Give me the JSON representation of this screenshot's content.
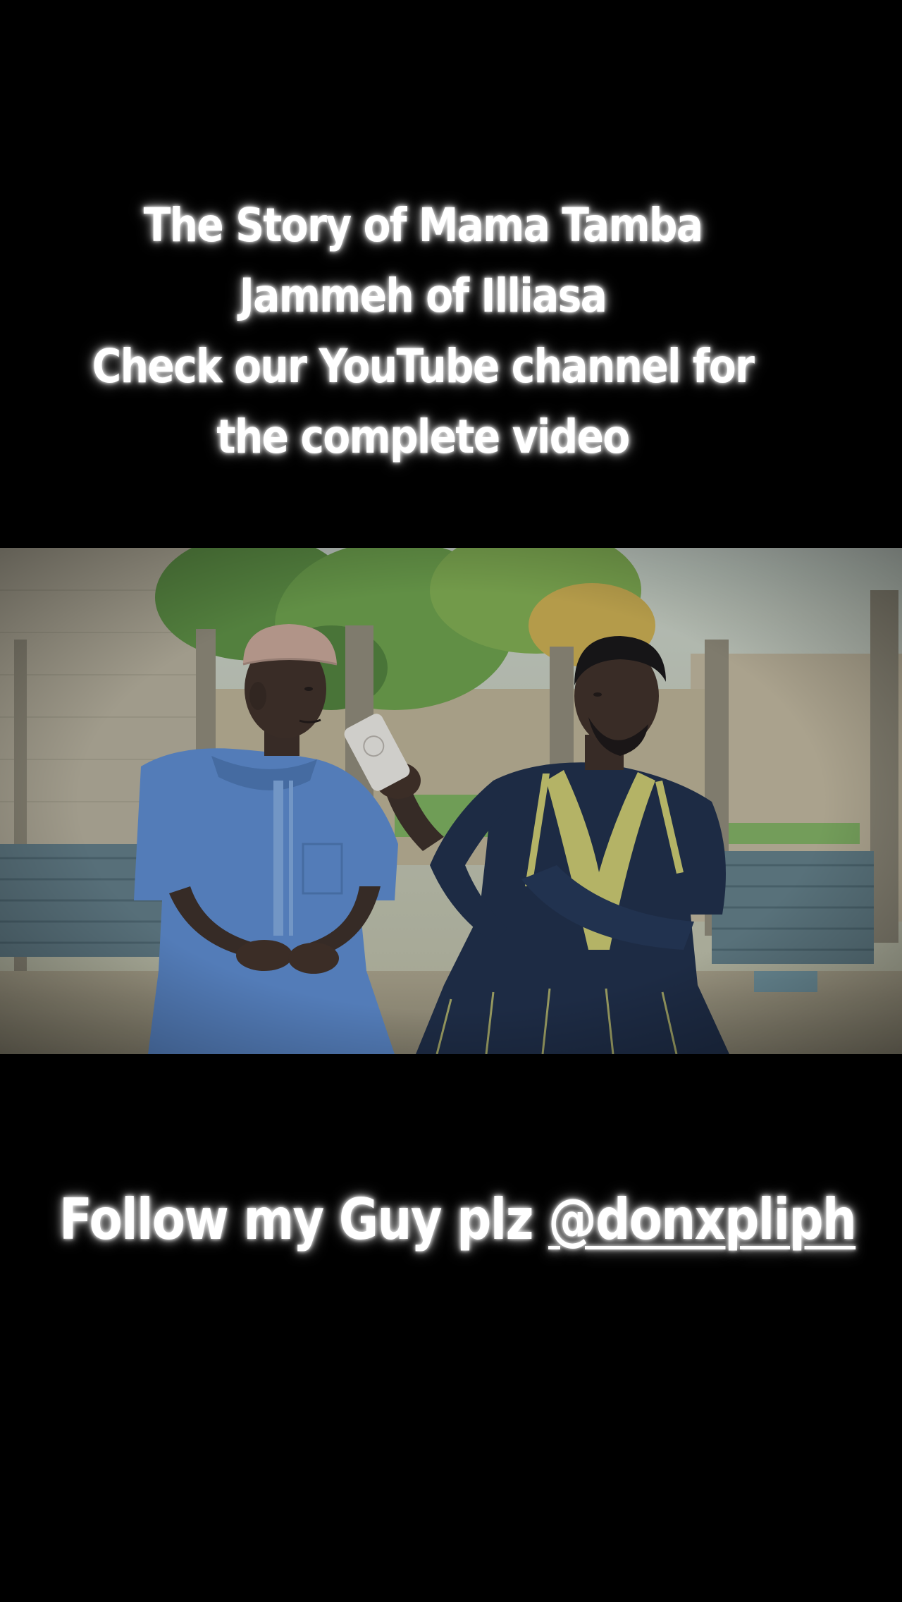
{
  "captions": {
    "top_lines": [
      "The Story of Mama Tamba",
      "Jammeh of Illiasa",
      "Check our YouTube channel for",
      "the complete video"
    ],
    "follow_prefix": "Follow my Guy plz ",
    "follow_handle": "@donxpliph"
  },
  "colors": {
    "background": "#000000",
    "caption_text": "#ffffff",
    "left_robe": "#5a86c8",
    "right_robe": "#1d2a44",
    "embroidery": "#c9c46a"
  }
}
